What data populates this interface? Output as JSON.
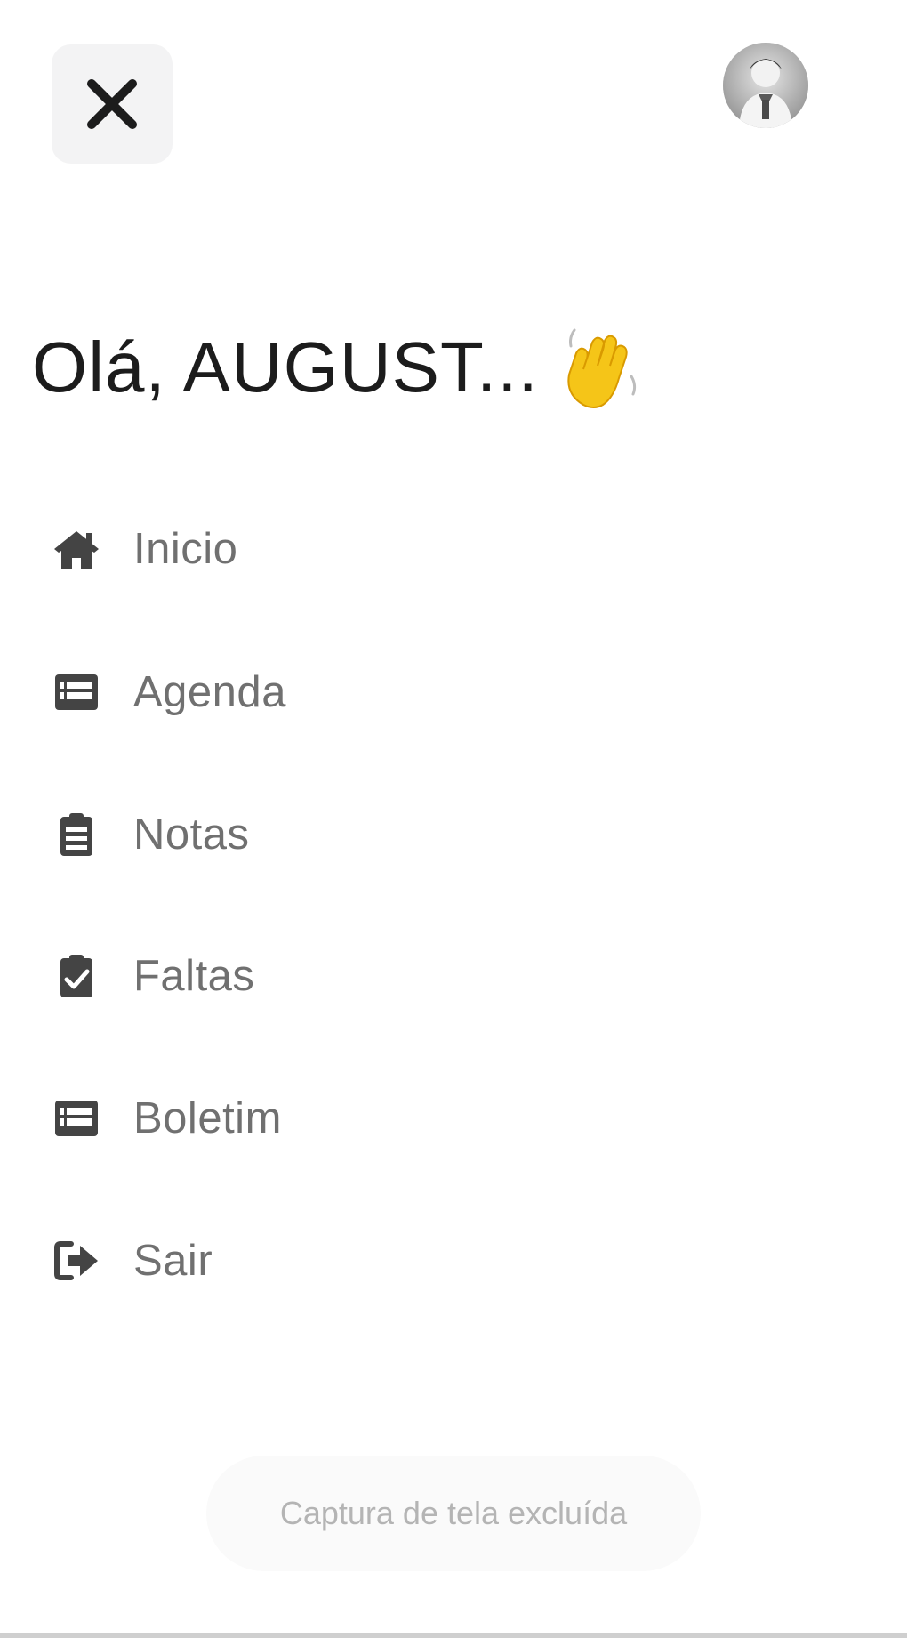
{
  "header": {
    "close_icon": "close-icon",
    "avatar_icon": "user-avatar"
  },
  "greeting": {
    "text": "Olá, AUGUST...",
    "emoji_icon": "waving-hand-icon"
  },
  "menu": {
    "items": [
      {
        "label": "Inicio",
        "icon": "home-icon"
      },
      {
        "label": "Agenda",
        "icon": "table-icon"
      },
      {
        "label": "Notas",
        "icon": "clipboard-list-icon"
      },
      {
        "label": "Faltas",
        "icon": "clipboard-check-icon"
      },
      {
        "label": "Boletim",
        "icon": "table-icon"
      },
      {
        "label": "Sair",
        "icon": "sign-out-icon"
      }
    ]
  },
  "toast": {
    "text": "Captura de tela excluída"
  }
}
